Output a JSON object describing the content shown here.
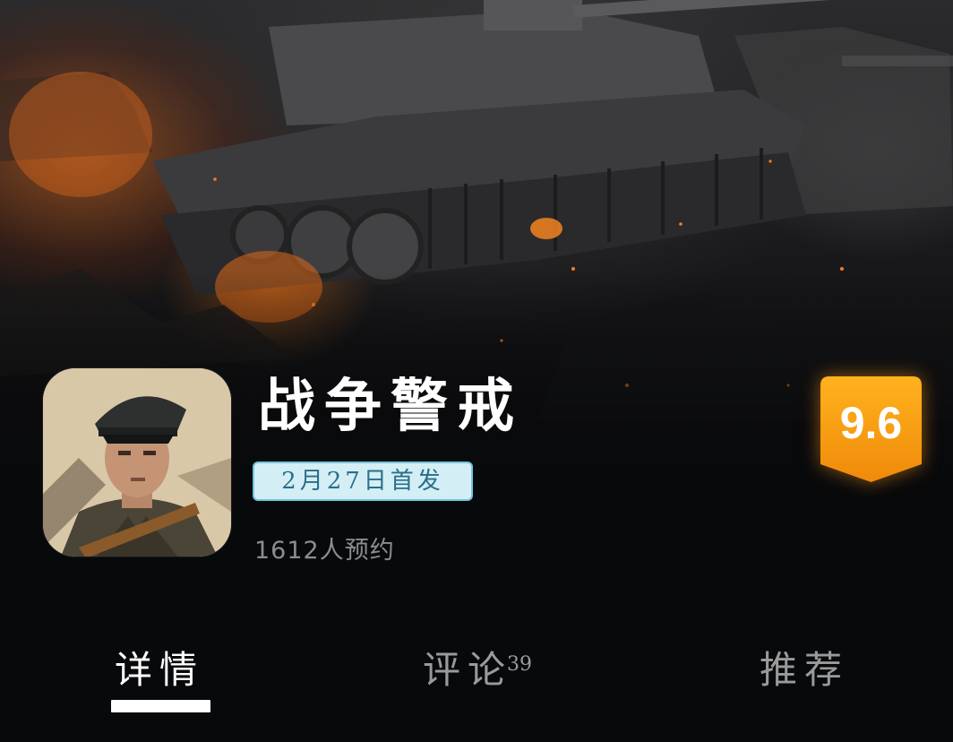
{
  "game": {
    "title": "战争警戒",
    "release_badge": "2月27日首发",
    "reservations": "1612人预约",
    "score": "9.6"
  },
  "tabs": [
    {
      "label": "详情",
      "active": true
    },
    {
      "label": "评论",
      "count": "39",
      "active": false
    },
    {
      "label": "推荐",
      "active": false
    }
  ],
  "colors": {
    "score_badge": "#f59a10",
    "release_badge_bg": "#d4eef6",
    "release_badge_text": "#2a6f88",
    "active_tab": "#ffffff",
    "inactive_tab": "#9a9a9a"
  }
}
